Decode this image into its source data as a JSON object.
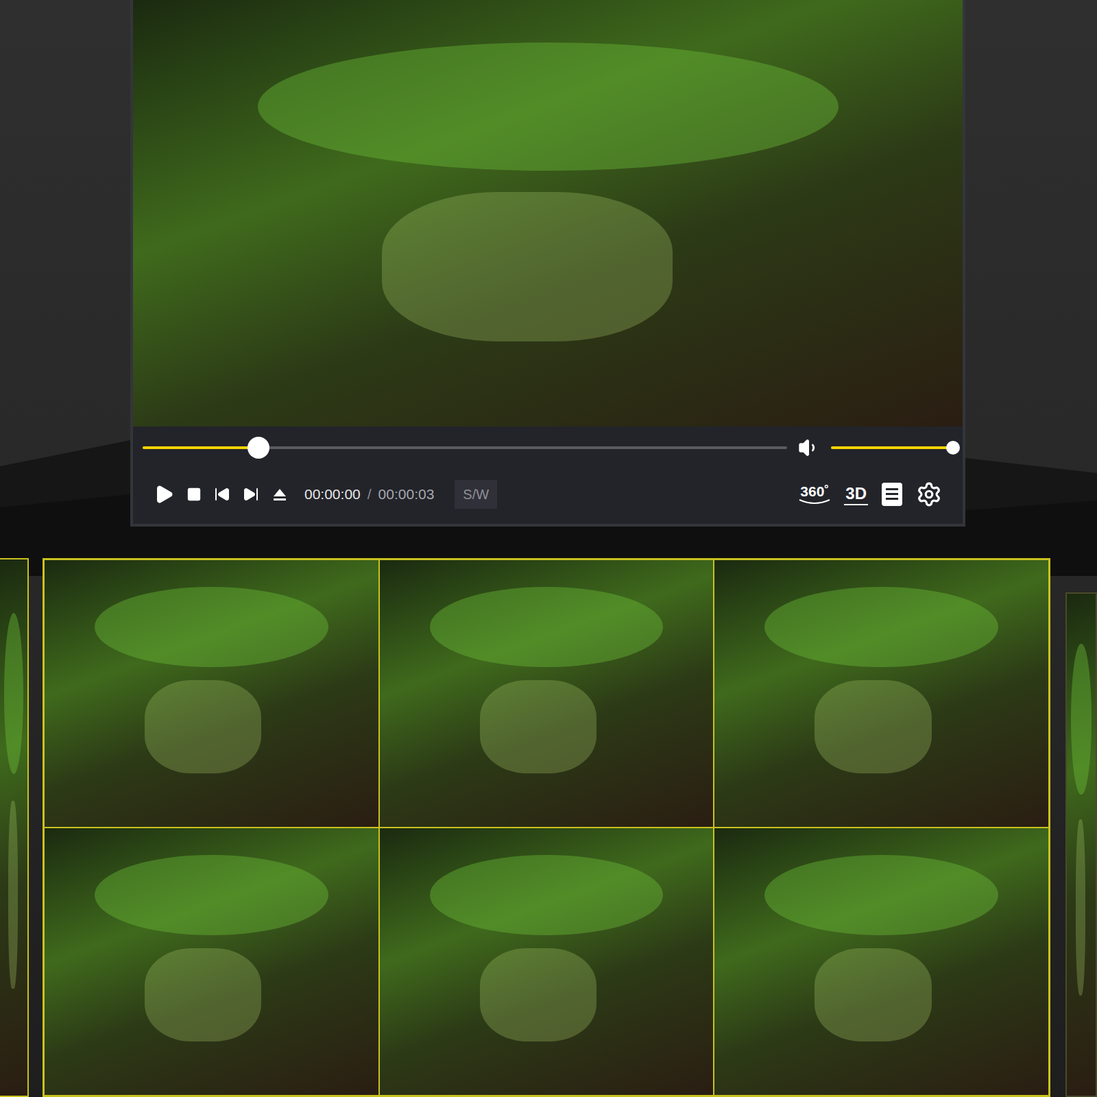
{
  "player": {
    "seek": {
      "level": 0.18
    },
    "volume": {
      "level": 1.0
    },
    "time": {
      "current": "00:00:00",
      "separator": "/",
      "total": "00:00:03"
    },
    "buttons": {
      "sw": "S/W",
      "vr": "360˚",
      "three_d": "3D"
    }
  }
}
